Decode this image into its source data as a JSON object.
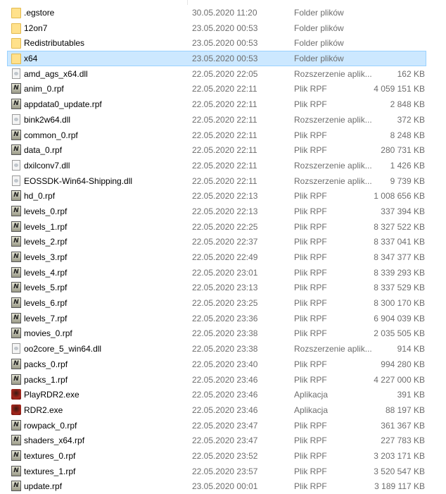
{
  "files": [
    {
      "name": ".egstore",
      "date": "30.05.2020 11:20",
      "type": "Folder plików",
      "size": "",
      "icon": "folder"
    },
    {
      "name": "12on7",
      "date": "23.05.2020 00:53",
      "type": "Folder plików",
      "size": "",
      "icon": "folder"
    },
    {
      "name": "Redistributables",
      "date": "23.05.2020 00:53",
      "type": "Folder plików",
      "size": "",
      "icon": "folder"
    },
    {
      "name": "x64",
      "date": "23.05.2020 00:53",
      "type": "Folder plików",
      "size": "",
      "icon": "folder",
      "selected": true
    },
    {
      "name": "amd_ags_x64.dll",
      "date": "22.05.2020 22:05",
      "type": "Rozszerzenie aplik...",
      "size": "162 KB",
      "icon": "dll"
    },
    {
      "name": "anim_0.rpf",
      "date": "22.05.2020 22:11",
      "type": "Plik RPF",
      "size": "4 059 151 KB",
      "icon": "rpf"
    },
    {
      "name": "appdata0_update.rpf",
      "date": "22.05.2020 22:11",
      "type": "Plik RPF",
      "size": "2 848 KB",
      "icon": "rpf"
    },
    {
      "name": "bink2w64.dll",
      "date": "22.05.2020 22:11",
      "type": "Rozszerzenie aplik...",
      "size": "372 KB",
      "icon": "dll"
    },
    {
      "name": "common_0.rpf",
      "date": "22.05.2020 22:11",
      "type": "Plik RPF",
      "size": "8 248 KB",
      "icon": "rpf"
    },
    {
      "name": "data_0.rpf",
      "date": "22.05.2020 22:11",
      "type": "Plik RPF",
      "size": "280 731 KB",
      "icon": "rpf"
    },
    {
      "name": "dxilconv7.dll",
      "date": "22.05.2020 22:11",
      "type": "Rozszerzenie aplik...",
      "size": "1 426 KB",
      "icon": "dll"
    },
    {
      "name": "EOSSDK-Win64-Shipping.dll",
      "date": "22.05.2020 22:11",
      "type": "Rozszerzenie aplik...",
      "size": "9 739 KB",
      "icon": "dll"
    },
    {
      "name": "hd_0.rpf",
      "date": "22.05.2020 22:13",
      "type": "Plik RPF",
      "size": "1 008 656 KB",
      "icon": "rpf"
    },
    {
      "name": "levels_0.rpf",
      "date": "22.05.2020 22:13",
      "type": "Plik RPF",
      "size": "337 394 KB",
      "icon": "rpf"
    },
    {
      "name": "levels_1.rpf",
      "date": "22.05.2020 22:25",
      "type": "Plik RPF",
      "size": "8 327 522 KB",
      "icon": "rpf"
    },
    {
      "name": "levels_2.rpf",
      "date": "22.05.2020 22:37",
      "type": "Plik RPF",
      "size": "8 337 041 KB",
      "icon": "rpf"
    },
    {
      "name": "levels_3.rpf",
      "date": "22.05.2020 22:49",
      "type": "Plik RPF",
      "size": "8 347 377 KB",
      "icon": "rpf"
    },
    {
      "name": "levels_4.rpf",
      "date": "22.05.2020 23:01",
      "type": "Plik RPF",
      "size": "8 339 293 KB",
      "icon": "rpf"
    },
    {
      "name": "levels_5.rpf",
      "date": "22.05.2020 23:13",
      "type": "Plik RPF",
      "size": "8 337 529 KB",
      "icon": "rpf"
    },
    {
      "name": "levels_6.rpf",
      "date": "22.05.2020 23:25",
      "type": "Plik RPF",
      "size": "8 300 170 KB",
      "icon": "rpf"
    },
    {
      "name": "levels_7.rpf",
      "date": "22.05.2020 23:36",
      "type": "Plik RPF",
      "size": "6 904 039 KB",
      "icon": "rpf"
    },
    {
      "name": "movies_0.rpf",
      "date": "22.05.2020 23:38",
      "type": "Plik RPF",
      "size": "2 035 505 KB",
      "icon": "rpf"
    },
    {
      "name": "oo2core_5_win64.dll",
      "date": "22.05.2020 23:38",
      "type": "Rozszerzenie aplik...",
      "size": "914 KB",
      "icon": "dll"
    },
    {
      "name": "packs_0.rpf",
      "date": "22.05.2020 23:40",
      "type": "Plik RPF",
      "size": "994 280 KB",
      "icon": "rpf"
    },
    {
      "name": "packs_1.rpf",
      "date": "22.05.2020 23:46",
      "type": "Plik RPF",
      "size": "4 227 000 KB",
      "icon": "rpf"
    },
    {
      "name": "PlayRDR2.exe",
      "date": "22.05.2020 23:46",
      "type": "Aplikacja",
      "size": "391 KB",
      "icon": "exe"
    },
    {
      "name": "RDR2.exe",
      "date": "22.05.2020 23:46",
      "type": "Aplikacja",
      "size": "88 197 KB",
      "icon": "exe"
    },
    {
      "name": "rowpack_0.rpf",
      "date": "22.05.2020 23:47",
      "type": "Plik RPF",
      "size": "361 367 KB",
      "icon": "rpf"
    },
    {
      "name": "shaders_x64.rpf",
      "date": "22.05.2020 23:47",
      "type": "Plik RPF",
      "size": "227 783 KB",
      "icon": "rpf"
    },
    {
      "name": "textures_0.rpf",
      "date": "22.05.2020 23:52",
      "type": "Plik RPF",
      "size": "3 203 171 KB",
      "icon": "rpf"
    },
    {
      "name": "textures_1.rpf",
      "date": "22.05.2020 23:57",
      "type": "Plik RPF",
      "size": "3 520 547 KB",
      "icon": "rpf"
    },
    {
      "name": "update.rpf",
      "date": "23.05.2020 00:01",
      "type": "Plik RPF",
      "size": "3 189 117 KB",
      "icon": "rpf"
    }
  ],
  "rpf_glyph": "N"
}
